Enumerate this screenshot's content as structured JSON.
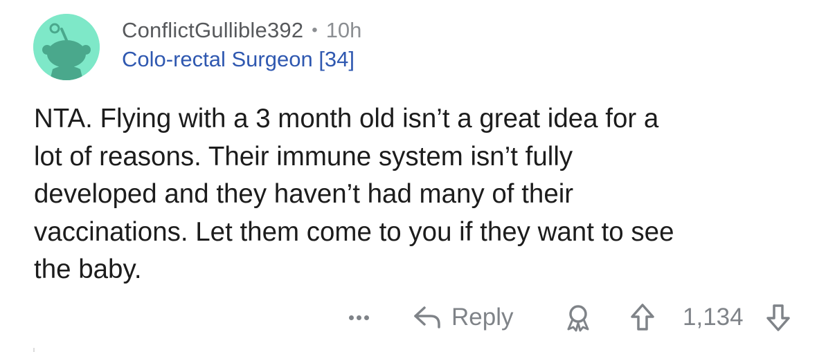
{
  "comment": {
    "username": "ConflictGullible392",
    "separator": "•",
    "time": "10h",
    "flair": "Colo-rectal Surgeon [34]",
    "body_lines": [
      "NTA. Flying with a 3 month old isn’t a great idea for a",
      "lot of reasons. Their immune system isn’t fully",
      "developed and they haven’t had many of their",
      "vaccinations. Let them come to you if they want to see",
      "the baby."
    ]
  },
  "actions": {
    "more_icon": "more-dots-icon",
    "reply_icon": "reply-arrow-icon",
    "reply_label": "Reply",
    "award_icon": "award-icon",
    "upvote_icon": "upvote-arrow-icon",
    "score": "1,134",
    "downvote_icon": "downvote-arrow-icon"
  },
  "avatar": {
    "icon": "reddit-snoo-avatar-icon",
    "background_color": "#7ee8c8",
    "figure_color": "#4aa88c"
  },
  "colors": {
    "username": "#57595c",
    "flair": "#2f58b0",
    "meta": "#8b8e92",
    "action": "#7f8388",
    "body": "#1c1c1c"
  }
}
